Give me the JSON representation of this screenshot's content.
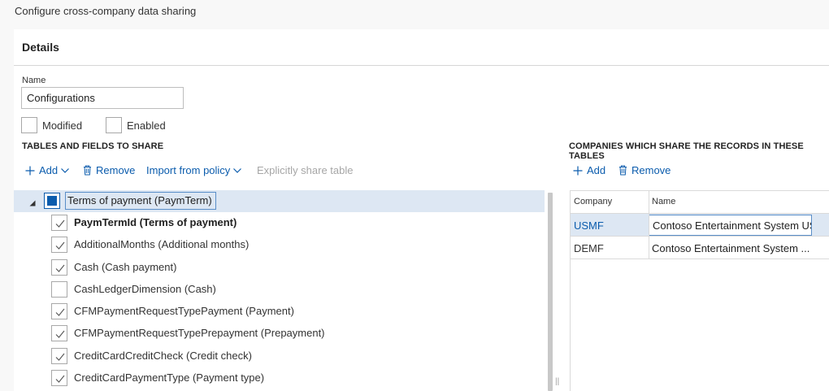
{
  "page": {
    "title": "Configure cross-company data sharing"
  },
  "details": {
    "title": "Details",
    "name_label": "Name",
    "name_value": "Configurations",
    "modified_label": "Modified",
    "enabled_label": "Enabled"
  },
  "tables_section": {
    "caption": "TABLES AND FIELDS TO SHARE",
    "toolbar": {
      "add": "Add",
      "remove": "Remove",
      "import_from_policy": "Import from policy",
      "explicitly_share_table": "Explicitly share table"
    },
    "tree": {
      "parent": {
        "label": "Terms of payment (PaymTerm)",
        "checked": "partial"
      },
      "fields": [
        {
          "label": "PaymTermId (Terms of payment)",
          "checked": true,
          "bold": true
        },
        {
          "label": "AdditionalMonths (Additional months)",
          "checked": true,
          "bold": false
        },
        {
          "label": "Cash (Cash payment)",
          "checked": true,
          "bold": false
        },
        {
          "label": "CashLedgerDimension (Cash)",
          "checked": false,
          "bold": false
        },
        {
          "label": "CFMPaymentRequestTypePayment (Payment)",
          "checked": true,
          "bold": false
        },
        {
          "label": "CFMPaymentRequestTypePrepayment (Prepayment)",
          "checked": true,
          "bold": false
        },
        {
          "label": "CreditCardCreditCheck (Credit check)",
          "checked": true,
          "bold": false
        },
        {
          "label": "CreditCardPaymentType (Payment type)",
          "checked": true,
          "bold": false
        }
      ]
    }
  },
  "companies_section": {
    "caption": "COMPANIES WHICH SHARE THE RECORDS IN THESE TABLES",
    "toolbar": {
      "add": "Add",
      "remove": "Remove"
    },
    "columns": [
      "Company",
      "Name"
    ],
    "rows": [
      {
        "company": "USMF",
        "name": "Contoso Entertainment System US"
      },
      {
        "company": "DEMF",
        "name": "Contoso Entertainment System ..."
      }
    ]
  },
  "colors": {
    "accent": "#0b5cad",
    "selected_row": "#dde7f3",
    "disabled": "#a6a6a6"
  }
}
